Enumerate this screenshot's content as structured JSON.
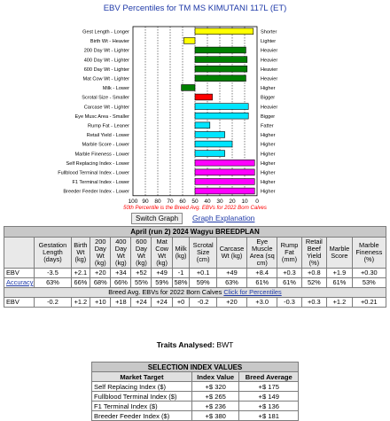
{
  "chart": {
    "title": "EBV Percentiles for TM MS KIMUTANI 117L (ET)",
    "note": "50th Percentile is the Breed Avg. EBVs for 2022 Born Calves",
    "x_ticks": [
      "100",
      "90",
      "80",
      "70",
      "60",
      "50",
      "40",
      "30",
      "20",
      "10",
      "0"
    ]
  },
  "chart_data": {
    "type": "bar",
    "title": "EBV Percentiles for TM MS KIMUTANI 117L (ET)",
    "xlim": [
      100,
      0
    ],
    "categories": [
      {
        "left": "Gest Length - Longer",
        "right": "Shorter",
        "start": 50,
        "end": 3,
        "color": "#ffff00"
      },
      {
        "left": "Birth Wt - Heavier",
        "right": "Lighter",
        "start": 59,
        "end": 50,
        "color": "#ffff00"
      },
      {
        "left": "200 Day Wt - Lighter",
        "right": "Heavier",
        "start": 50,
        "end": 9,
        "color": "#008000"
      },
      {
        "left": "400 Day Wt - Lighter",
        "right": "Heavier",
        "start": 50,
        "end": 8,
        "color": "#008000"
      },
      {
        "left": "600 Day Wt - Lighter",
        "right": "Heavier",
        "start": 50,
        "end": 8,
        "color": "#008000"
      },
      {
        "left": "Mat Cow Wt - Lighter",
        "right": "Heavier",
        "start": 50,
        "end": 9,
        "color": "#008000"
      },
      {
        "left": "Milk - Lower",
        "right": "Higher",
        "start": 61,
        "end": 50,
        "color": "#008000"
      },
      {
        "left": "Scrotal Size - Smaller",
        "right": "Bigger",
        "start": 50,
        "end": 36,
        "color": "#ff0000"
      },
      {
        "left": "Carcase Wt - Lighter",
        "right": "Heavier",
        "start": 50,
        "end": 7,
        "color": "#00e5ff"
      },
      {
        "left": "Eye Musc Area - Smaller",
        "right": "Bigger",
        "start": 50,
        "end": 7,
        "color": "#00e5ff"
      },
      {
        "left": "Rump Fat - Leaner",
        "right": "Fatter",
        "start": 50,
        "end": 38,
        "color": "#00e5ff"
      },
      {
        "left": "Retail Yield - Lower",
        "right": "Higher",
        "start": 50,
        "end": 26,
        "color": "#00e5ff"
      },
      {
        "left": "Marble Score - Lower",
        "right": "Higher",
        "start": 50,
        "end": 20,
        "color": "#00e5ff"
      },
      {
        "left": "Marble Fineness - Lower",
        "right": "Higher",
        "start": 50,
        "end": 26,
        "color": "#00e5ff"
      },
      {
        "left": "Self Replacing Index - Lower",
        "right": "Higher",
        "start": 50,
        "end": 2,
        "color": "#ff00ff"
      },
      {
        "left": "Fullblood Terminal Index - Lower",
        "right": "Higher",
        "start": 50,
        "end": 2,
        "color": "#ff00ff"
      },
      {
        "left": "F1 Terminal Index - Lower",
        "right": "Higher",
        "start": 50,
        "end": 2,
        "color": "#ff00ff"
      },
      {
        "left": "Breeder Feeder Index - Lower",
        "right": "Higher",
        "start": 50,
        "end": 2,
        "color": "#ff00ff"
      }
    ]
  },
  "controls": {
    "switch_label": "Switch Graph",
    "graph_link": "Graph Explanation"
  },
  "breedplan": {
    "title": "April (run 2) 2024 Wagyu BREEDPLAN",
    "headers": [
      "",
      "Gestation Length (days)",
      "Birth Wt (kg)",
      "200 Day Wt (kg)",
      "400 Day Wt (kg)",
      "600 Day Wt (kg)",
      "Mat Cow Wt (kg)",
      "Milk (kg)",
      "Scrotal Size (cm)",
      "Carcase Wt (kg)",
      "Eye Muscle Area (sq cm)",
      "Rump Fat (mm)",
      "Retail Beef Yield (%)",
      "Marble Score",
      "Marble Fineness (%)"
    ],
    "ebv": [
      "EBV",
      "-3.5",
      "+2.1",
      "+20",
      "+34",
      "+52",
      "+49",
      "-1",
      "+0.1",
      "+49",
      "+8.4",
      "+0.3",
      "+0.8",
      "+1.9",
      "+0.30"
    ],
    "accuracy": [
      "Accuracy",
      "63%",
      "66%",
      "68%",
      "66%",
      "55%",
      "59%",
      "58%",
      "59%",
      "63%",
      "61%",
      "61%",
      "52%",
      "61%",
      "53%"
    ],
    "avg_label": "Breed Avg. EBVs for 2022 Born Calves",
    "avg_link": "Click for Percentiles",
    "avg": [
      "EBV",
      "-0.2",
      "+1.2",
      "+10",
      "+18",
      "+24",
      "+24",
      "+0",
      "-0.2",
      "+20",
      "+3.0",
      "-0.3",
      "+0.3",
      "+1.2",
      "+0.21"
    ]
  },
  "traits": {
    "label": "Traits Analysed:",
    "value": "BWT"
  },
  "selection": {
    "title": "SELECTION INDEX VALUES",
    "headers": [
      "Market Target",
      "Index Value",
      "Breed Average"
    ],
    "rows": [
      {
        "name": "Self Replacing Index ($)",
        "value": "+$ 320",
        "avg": "+$ 175"
      },
      {
        "name": "Fullblood Terminal Index ($)",
        "value": "+$ 265",
        "avg": "+$ 149"
      },
      {
        "name": "F1 Terminal Index ($)",
        "value": "+$ 236",
        "avg": "+$ 136"
      },
      {
        "name": "Breeder Feeder Index ($)",
        "value": "+$ 380",
        "avg": "+$ 181"
      }
    ]
  }
}
